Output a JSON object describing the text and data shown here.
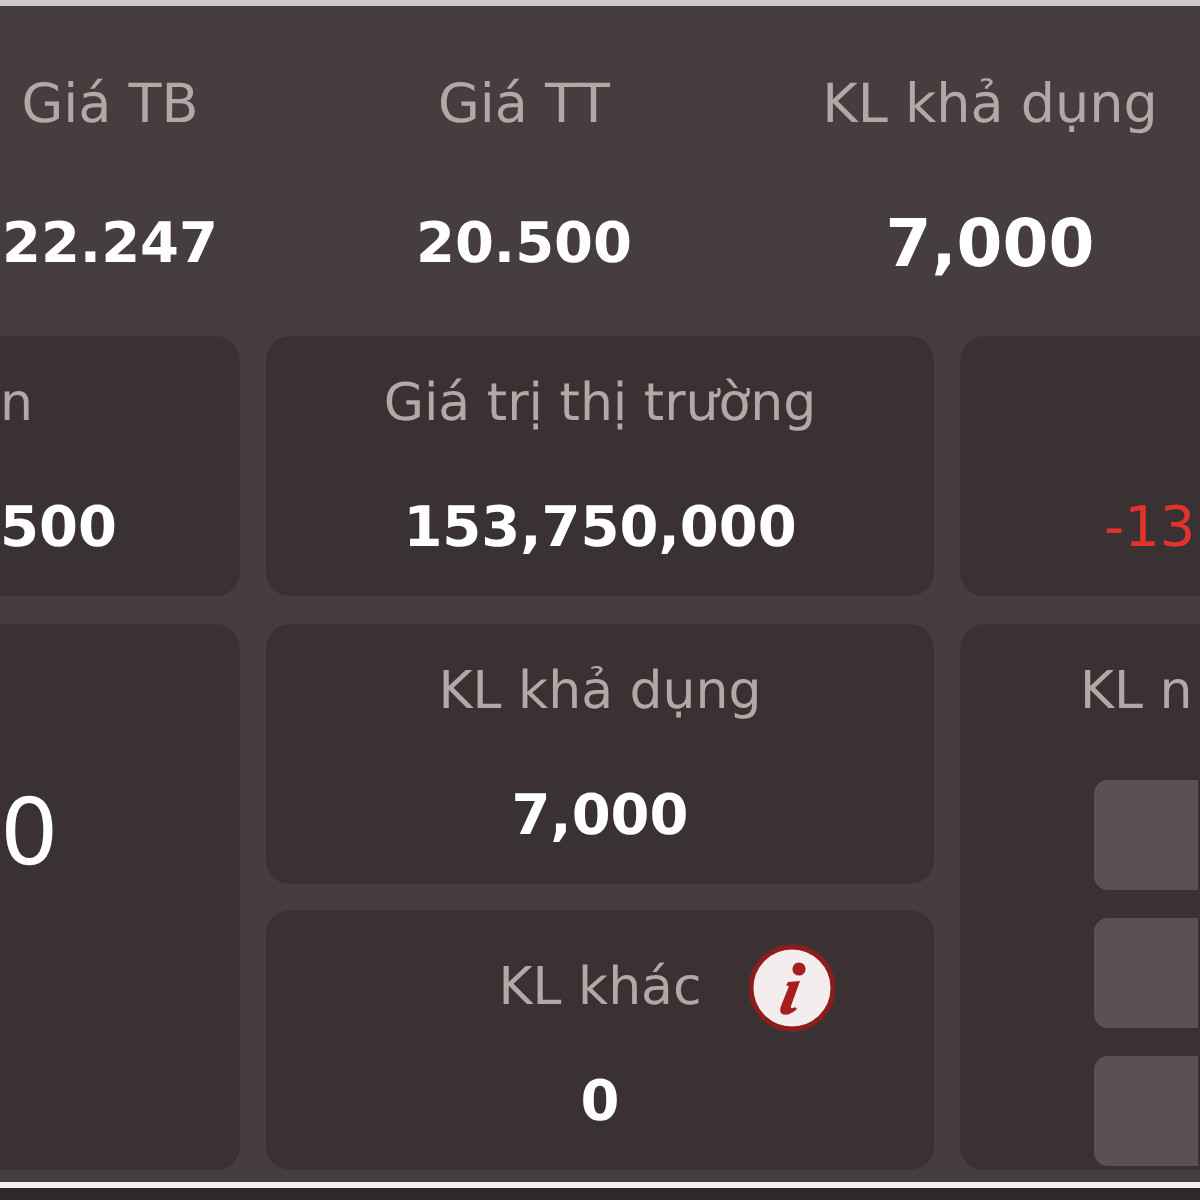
{
  "summary": [
    {
      "label": "Giá TB",
      "value": "22.247"
    },
    {
      "label": "Giá TT",
      "value": "20.500"
    },
    {
      "label": "KL khả dụng",
      "value": "7,000"
    }
  ],
  "cards": [
    {
      "label": "n",
      "value": "500",
      "negative": false,
      "info": false
    },
    {
      "label": "Giá trị thị trường",
      "value": "153,750,000",
      "negative": false,
      "info": false
    },
    {
      "value": "-13",
      "negative": true,
      "info": false
    },
    {
      "value": "0",
      "negative": false,
      "info": false
    },
    {
      "label": "KL khả dụng",
      "value": "7,000",
      "negative": false,
      "info": false
    },
    {
      "label": "KL khác",
      "value": "0",
      "negative": false,
      "info": true
    },
    {
      "label": "KL n",
      "info": false,
      "options": [
        {
          "kind": "button"
        },
        {
          "kind": "button"
        },
        {
          "kind": "button"
        }
      ]
    }
  ]
}
